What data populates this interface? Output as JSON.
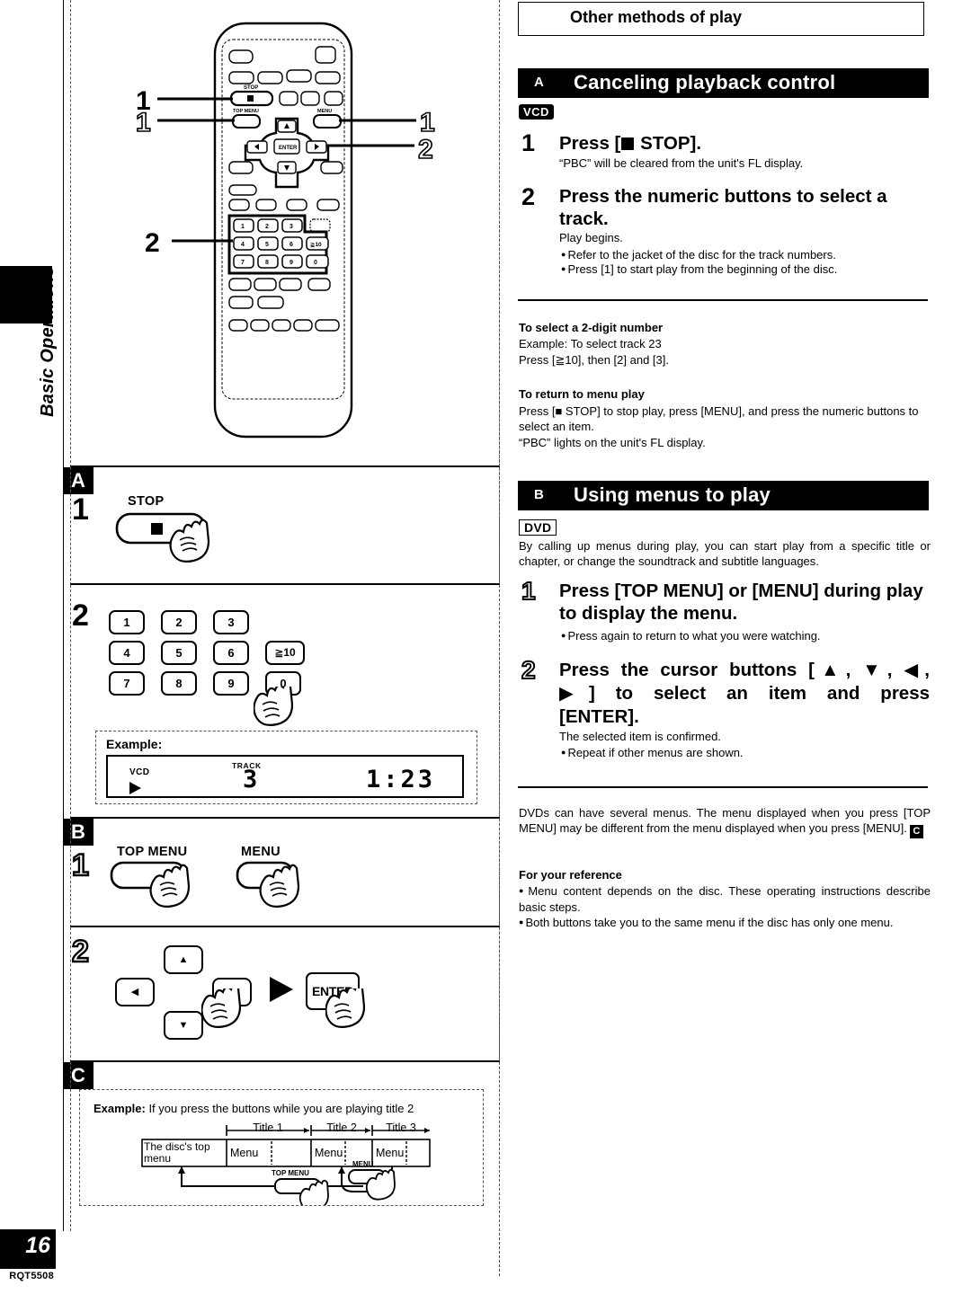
{
  "sidebar": {
    "section_label": "Basic Operations",
    "page_number": "16",
    "doc_code": "RQT5508"
  },
  "header": {
    "title": "Other methods of play"
  },
  "sections": [
    {
      "letter": "A",
      "title": "Canceling playback control",
      "disc_badge": "VCD",
      "steps": [
        {
          "num": "1",
          "heading_prefix": "Press [",
          "heading_suffix": " STOP].",
          "sub": "“PBC” will be cleared from the unit's FL display.",
          "bullets": []
        },
        {
          "num": "2",
          "heading": "Press the numeric buttons to select a track.",
          "sub": "Play begins.",
          "bullets": [
            "Refer to the jacket of the disc for the track numbers.",
            "Press [1] to start play from the beginning of the disc."
          ]
        }
      ],
      "notes": [
        {
          "title": "To select a 2-digit number",
          "lines": [
            "Example:  To select track 23",
            "Press [≧10], then [2] and [3]."
          ]
        },
        {
          "title": "To return to menu play",
          "lines_rich": [
            "Press [■ STOP] to stop play, press [MENU], and press the numeric buttons to select an item.",
            "“PBC” lights on the unit's FL display."
          ]
        }
      ]
    },
    {
      "letter": "B",
      "title": "Using menus to play",
      "disc_badge": "DVD",
      "intro": "By calling up menus during play, you can start play from a specific title or chapter, or change the soundtrack and subtitle languages.",
      "steps": [
        {
          "num": "1",
          "heading": "Press [TOP MENU] or [MENU] during play to display the menu.",
          "bullets": [
            "Press again to return to what you were watching."
          ]
        },
        {
          "num": "2",
          "heading_line1": "Press the cursor buttons [▲, ▼, ◀,",
          "heading_line2": "▶] to select an item and press",
          "heading_line3": "[ENTER].",
          "sub": "The selected item is confirmed.",
          "bullets": [
            "Repeat if other menus are shown."
          ]
        }
      ],
      "footer_para": "DVDs can have several menus. The menu displayed when you press [TOP MENU] may be different from the menu displayed when you press [MENU].",
      "footer_para_badge": "C",
      "reference": {
        "title": "For your reference",
        "bullets": [
          "Menu content depends on the disc. These operating instructions describe basic steps.",
          "Both buttons take you to the same menu if the disc has only one menu."
        ]
      }
    }
  ],
  "remote": {
    "callouts": [
      "1",
      "1",
      "1",
      "2",
      "2"
    ],
    "labels": {
      "stop": "STOP",
      "top_menu": "TOP MENU",
      "menu": "MENU",
      "enter": "ENTER"
    },
    "numeric_keys": [
      "1",
      "2",
      "3",
      "4",
      "5",
      "6",
      "≧10",
      "7",
      "8",
      "9",
      "0"
    ]
  },
  "panel_a": {
    "letter": "A",
    "step1": {
      "num": "1",
      "button_label": "STOP"
    },
    "step2": {
      "num": "2",
      "keys": [
        "1",
        "2",
        "3",
        "4",
        "5",
        "6",
        "≧10",
        "7",
        "8",
        "9",
        "0"
      ],
      "example_label": "Example:",
      "display": {
        "vcd": "VCD",
        "track_label": "TRACK",
        "track_number": "3",
        "time": "1:23"
      }
    }
  },
  "panel_b": {
    "letter": "B",
    "step1": {
      "num": "1",
      "buttons": [
        "TOP MENU",
        "MENU"
      ]
    },
    "step2": {
      "num": "2",
      "cursors": [
        "▲",
        "◀",
        "▶",
        "▼"
      ],
      "enter": "ENTER"
    }
  },
  "panel_c": {
    "letter": "C",
    "example_bold": "Example:",
    "example_text": "If you press the buttons while you are playing title 2",
    "titles": [
      "Title 1",
      "Title 2",
      "Title 3"
    ],
    "top_menu_cell": "The disc's top menu",
    "menu_cells": [
      "Menu",
      "Menu",
      "Menu"
    ],
    "arrow_labels": {
      "menu": "MENU",
      "top_menu": "TOP MENU"
    }
  }
}
